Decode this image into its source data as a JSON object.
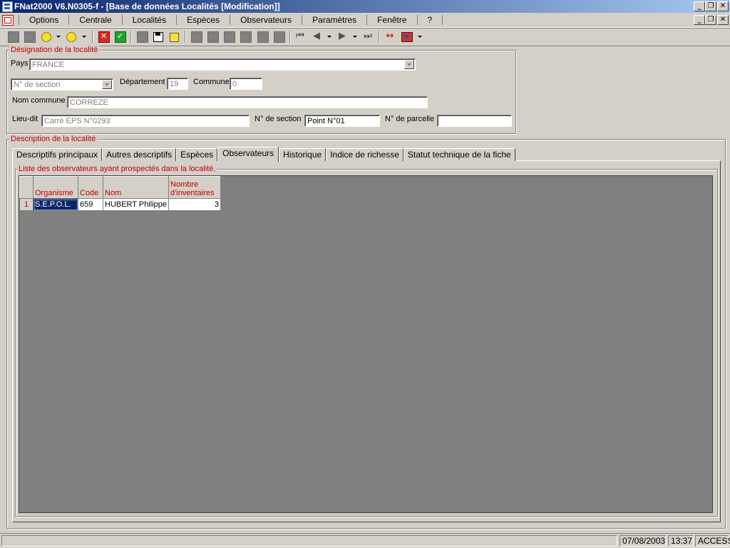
{
  "window": {
    "title": "FNat2000 V6.N0305-f - [Base de données Localités [Modification]]"
  },
  "menu": [
    "Options",
    "Centrale",
    "Localités",
    "Espèces",
    "Observateurs",
    "Paramètres",
    "Fenêtre",
    "?"
  ],
  "designation": {
    "legend": "Désignation de la localité",
    "pays_label": "Pays",
    "pays_value": "FRANCE",
    "section_combo": "N° de section",
    "departement_label": "Département",
    "departement_value": "19",
    "commune_label": "Commune",
    "commune_value": "0",
    "nom_commune_label": "Nom commune",
    "nom_commune_value": "CORREZE",
    "lieu_dit_label": "Lieu-dit",
    "lieu_dit_value": "Carré EPS N°0293",
    "section_label": "N° de section",
    "section_value": "Point N°01",
    "parcelle_label": "N° de parcelle",
    "parcelle_value": ""
  },
  "description": {
    "legend": "Description de la localité",
    "tabs": [
      "Descriptifs principaux",
      "Autres descriptifs",
      "Espèces",
      "Observateurs",
      "Historique",
      "Indice de richesse",
      "Statut technique de la fiche"
    ],
    "active_tab": "Observateurs",
    "list_legend": "Liste des observateurs ayant prospectés dans la localité.",
    "columns": [
      "Organisme",
      "Code",
      "Nom",
      "Nombre d'inventaires"
    ],
    "rows": [
      {
        "n": "1",
        "organisme": "S.E.P.O.L.",
        "code": "659",
        "nom": "HUBERT Philippe",
        "nombre": "3"
      }
    ]
  },
  "status": {
    "date": "07/08/2003",
    "time": "13:37",
    "mode": "ACCESS"
  }
}
